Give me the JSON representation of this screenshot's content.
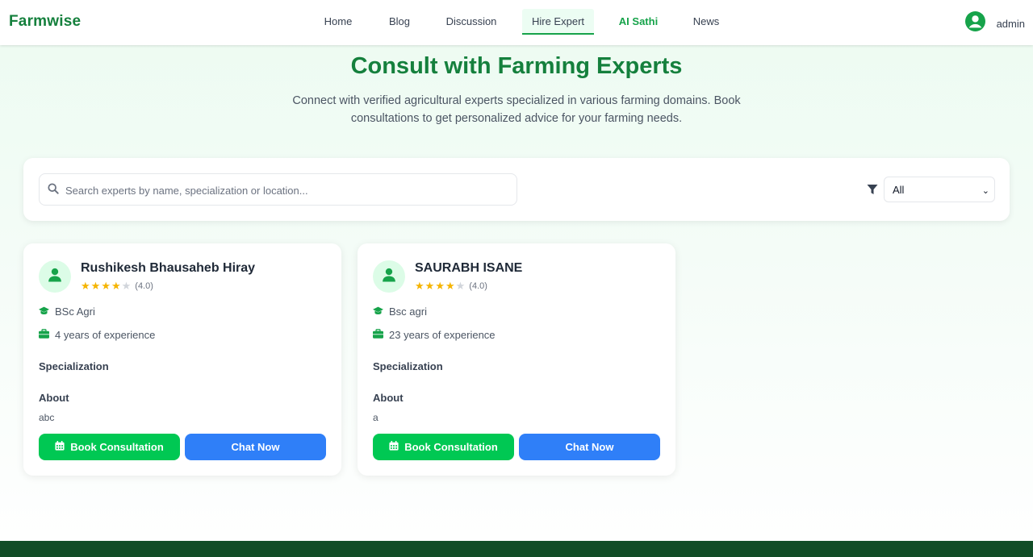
{
  "brand": "Farmwise",
  "nav": {
    "links": [
      "Home",
      "Blog",
      "Discussion",
      "Hire Expert",
      "AI Sathi",
      "News"
    ],
    "active": "Hire Expert"
  },
  "user": {
    "name": "admin",
    "icon": "user-circle-icon"
  },
  "hero": {
    "title": "Consult with Farming Experts",
    "subtitle": "Connect with verified agricultural experts specialized in various farming domains. Book consultations to get personalized advice for your farming needs."
  },
  "search": {
    "placeholder": "Search experts by name, specialization or location...",
    "value": "",
    "filter_value": "All"
  },
  "experts": [
    {
      "name": "Rushikesh Bhausaheb Hiray",
      "rating": 4,
      "rating_text": "(4.0)",
      "qualification": "BSc Agri",
      "experience": "4 years of experience",
      "specialization_label": "Specialization",
      "about_label": "About",
      "about": "abc",
      "book_label": "Book Consultation",
      "chat_label": "Chat Now"
    },
    {
      "name": "SAURABH ISANE",
      "rating": 4,
      "rating_text": "(4.0)",
      "qualification": "Bsc agri",
      "experience": "23 years of experience",
      "specialization_label": "Specialization",
      "about_label": "About",
      "about": "a",
      "book_label": "Book Consultation",
      "chat_label": "Chat Now"
    }
  ],
  "colors": {
    "brand_green": "#15803d",
    "button_green": "#00c853",
    "button_blue": "#2f7ff8",
    "star": "#f5b400",
    "footer": "#114d27"
  }
}
